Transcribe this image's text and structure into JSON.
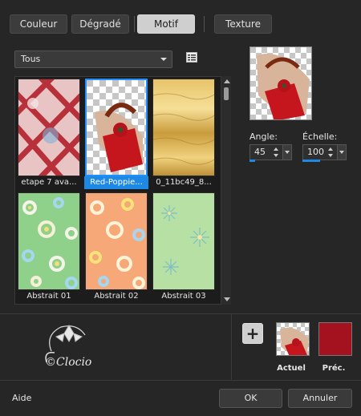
{
  "tabs": [
    {
      "label": "Couleur"
    },
    {
      "label": "Dégradé"
    },
    {
      "label": "Motif"
    },
    {
      "label": "Texture"
    }
  ],
  "category_select": {
    "value": "Tous"
  },
  "gallery": {
    "items": [
      {
        "caption": "etape 7 ava..."
      },
      {
        "caption": "Red-Poppie..."
      },
      {
        "caption": "0_11bc49_8..."
      },
      {
        "caption": "Abstrait 01"
      },
      {
        "caption": "Abstrait 02"
      },
      {
        "caption": "Abstrait 03"
      }
    ]
  },
  "angle": {
    "label": "Angle:",
    "value": "45"
  },
  "scale": {
    "label": "Échelle:",
    "value": "100"
  },
  "current": {
    "label": "Actuel"
  },
  "previous": {
    "label": "Préc.",
    "color": "#a3121e"
  },
  "signature": {
    "text": "©Clocio"
  },
  "footer": {
    "help": "Aide",
    "ok": "OK",
    "cancel": "Annuler"
  }
}
